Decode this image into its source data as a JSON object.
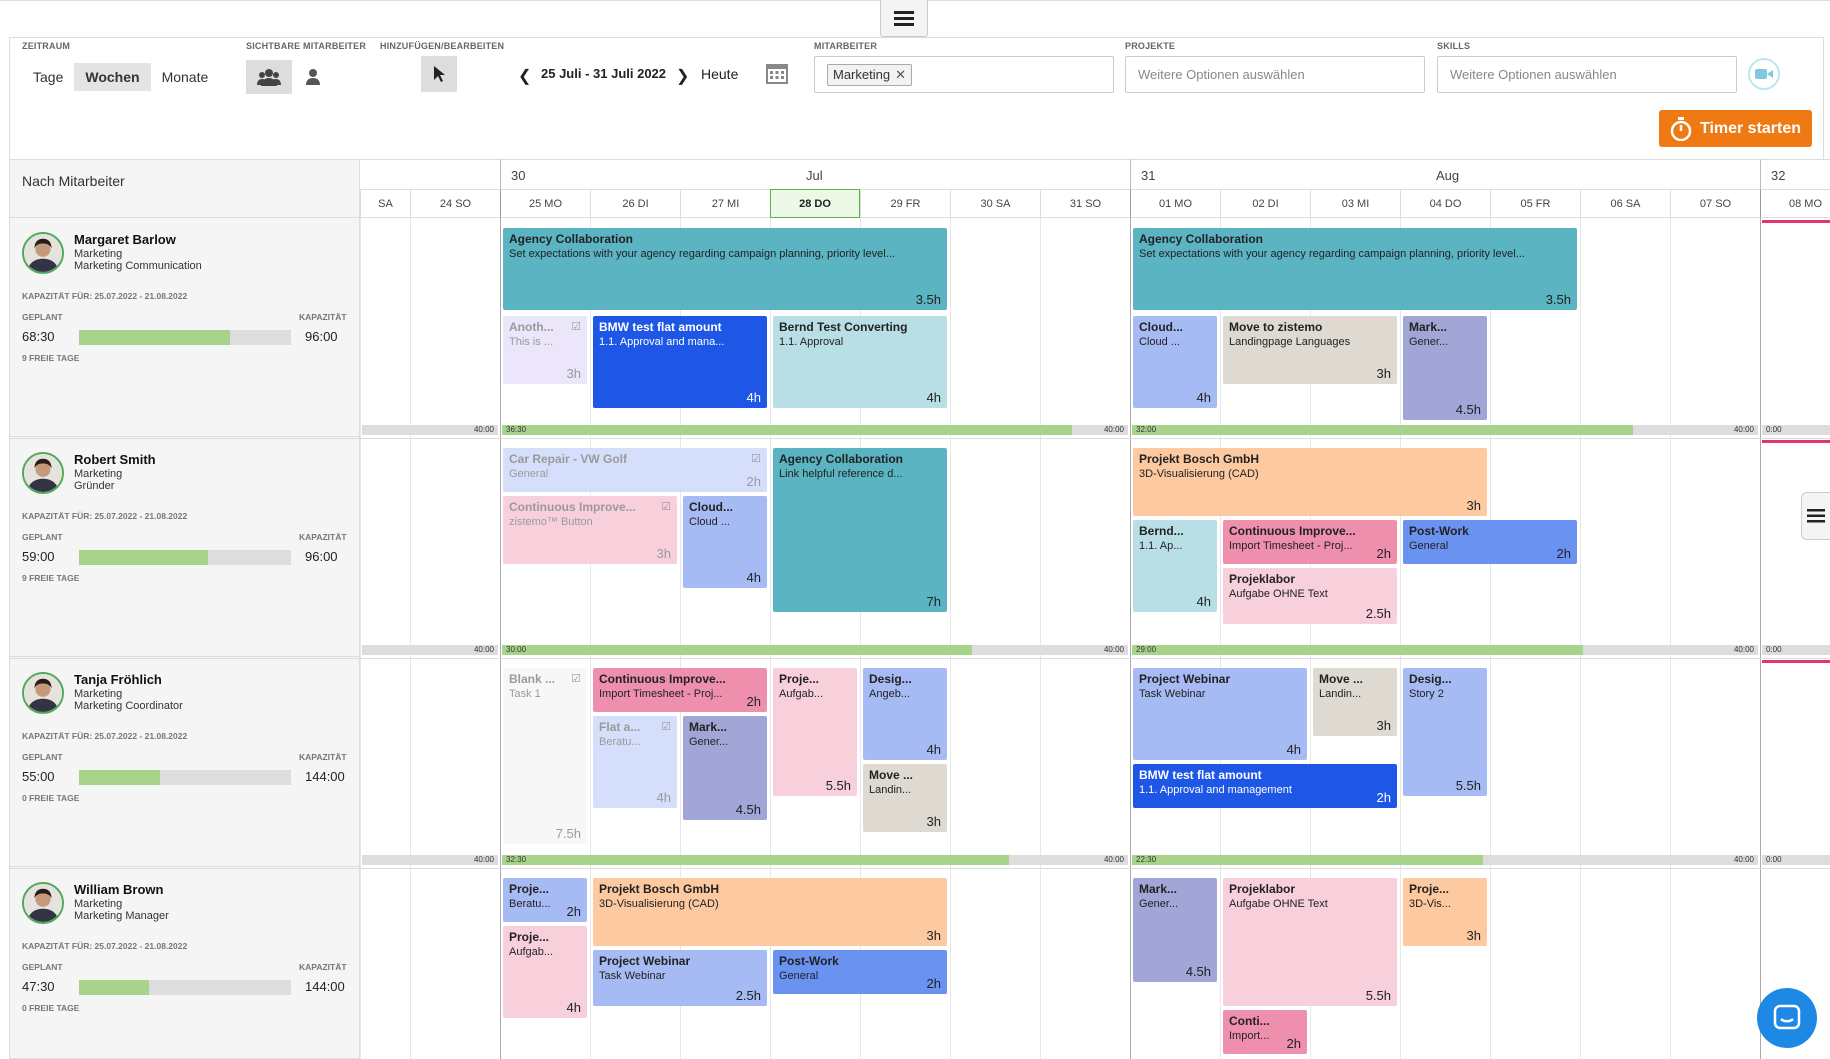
{
  "toolbar": {
    "zeitraum_label": "ZEITRAUM",
    "sichtbare_label": "SICHTBARE MITARBEITER",
    "hinzufuegen_label": "HINZUFÜGEN/BEARBEITEN",
    "mitarbeiter_label": "MITARBEITER",
    "projekte_label": "PROJEKTE",
    "skills_label": "SKILLS",
    "tage": "Tage",
    "wochen": "Wochen",
    "monate": "Monate",
    "date_range": "25 Juli - 31 Juli 2022",
    "heute": "Heute",
    "mitarbeiter_chip": "Marketing",
    "projekte_placeholder": "Weitere Optionen auswählen",
    "skills_placeholder": "Weitere Optionen auswählen",
    "timer": "Timer starten"
  },
  "calendar": {
    "group_label": "Nach Mitarbeiter",
    "weeks": [
      {
        "num": "30",
        "month": "Jul"
      },
      {
        "num": "31",
        "month": "Aug"
      },
      {
        "num": "32",
        "month": ""
      }
    ],
    "days": [
      "SA",
      "24 SO",
      "25 MO",
      "26 DI",
      "27 MI",
      "28 DO",
      "29 FR",
      "30 SA",
      "31 SO",
      "01 MO",
      "02 DI",
      "03 MI",
      "04 DO",
      "05 FR",
      "06 SA",
      "07 SO",
      "08 MO"
    ],
    "today": "28 DO"
  },
  "employees": [
    {
      "name": "Margaret Barlow",
      "dept": "Marketing",
      "role": "Marketing Communication",
      "kap": "KAPAZITÄT FÜR: 25.07.2022 - 21.08.2022",
      "geplant_label": "GEPLANT",
      "kapazitaet_label": "KAPAZITÄT",
      "geplant": "68:30",
      "kapazitaet": "96:00",
      "progress": 0.71,
      "free": "9 FREIE TAGE",
      "caps": [
        {
          "a": "",
          "b": "40:00"
        },
        {
          "a": "36:30",
          "b": "40:00",
          "p": 0.91
        },
        {
          "a": "32:00",
          "b": "40:00",
          "p": 0.8
        },
        {
          "a": "0:00",
          "b": ""
        }
      ]
    },
    {
      "name": "Robert Smith",
      "dept": "Marketing",
      "role": "Gründer",
      "kap": "KAPAZITÄT FÜR: 25.07.2022 - 21.08.2022",
      "geplant_label": "GEPLANT",
      "kapazitaet_label": "KAPAZITÄT",
      "geplant": "59:00",
      "kapazitaet": "96:00",
      "progress": 0.61,
      "free": "9 FREIE TAGE",
      "caps": [
        {
          "a": "",
          "b": "40:00"
        },
        {
          "a": "30:00",
          "b": "40:00",
          "p": 0.75
        },
        {
          "a": "29:00",
          "b": "40:00",
          "p": 0.72
        },
        {
          "a": "0:00",
          "b": ""
        }
      ]
    },
    {
      "name": "Tanja Fröhlich",
      "dept": "Marketing",
      "role": "Marketing Coordinator",
      "kap": "KAPAZITÄT FÜR: 25.07.2022 - 21.08.2022",
      "geplant_label": "GEPLANT",
      "kapazitaet_label": "KAPAZITÄT",
      "geplant": "55:00",
      "kapazitaet": "144:00",
      "progress": 0.38,
      "free": "0 FREIE TAGE",
      "caps": [
        {
          "a": "",
          "b": "40:00"
        },
        {
          "a": "32:30",
          "b": "40:00",
          "p": 0.81
        },
        {
          "a": "22:30",
          "b": "40:00",
          "p": 0.56
        },
        {
          "a": "0:00",
          "b": ""
        }
      ]
    },
    {
      "name": "William Brown",
      "dept": "Marketing",
      "role": "Marketing Manager",
      "kap": "KAPAZITÄT FÜR: 25.07.2022 - 21.08.2022",
      "geplant_label": "GEPLANT",
      "kapazitaet_label": "KAPAZITÄT",
      "geplant": "47:30",
      "kapazitaet": "144:00",
      "progress": 0.33,
      "free": "0 FREIE TAGE",
      "caps": []
    }
  ],
  "colors": {
    "teal": "#5ab4c1",
    "blue": "#1e56e6",
    "lightblue": "#b9dfe6",
    "grey": "#dedad2",
    "purple": "#a1a6d6",
    "pink": "#f8d0dc",
    "hotpink": "#ef8fae",
    "peach": "#fdc9a0",
    "periwinkle": "#a6baf4",
    "medblue": "#6a92f1",
    "lavender": "#ece6fb",
    "paleblue": "#d5dffb",
    "today": "#eef8e7",
    "accent": "#ef7a14"
  },
  "tasks": [
    {
      "r": 0,
      "c": 2,
      "w": 5,
      "t": 0,
      "hgt": 82,
      "col": "teal",
      "title": "Agency Collaboration",
      "sub": "Set expectations with your agency regarding campaign planning, priority level...",
      "hours": "3.5h"
    },
    {
      "r": 0,
      "c": 9,
      "w": 5,
      "t": 0,
      "hgt": 82,
      "col": "teal",
      "title": "Agency Collaboration",
      "sub": "Set expectations with your agency regarding campaign planning, priority level...",
      "hours": "3.5h"
    },
    {
      "r": 0,
      "c": 2,
      "w": 1,
      "t": 88,
      "hgt": 68,
      "col": "lavender",
      "title": "Anoth...",
      "sub": "This is ...",
      "hours": "3h",
      "done": true
    },
    {
      "r": 0,
      "c": 3,
      "w": 2,
      "t": 88,
      "hgt": 92,
      "col": "blue",
      "title": "BMW test flat amount",
      "sub": "1.1. Approval and mana...",
      "hours": "4h",
      "light": true
    },
    {
      "r": 0,
      "c": 5,
      "w": 2,
      "t": 88,
      "hgt": 92,
      "col": "lightblue",
      "title": "Bernd Test Converting",
      "sub": "1.1. Approval",
      "hours": "4h"
    },
    {
      "r": 0,
      "c": 9,
      "w": 1,
      "t": 88,
      "hgt": 92,
      "col": "periwinkle",
      "title": "Cloud...",
      "sub": "Cloud ...",
      "hours": "4h"
    },
    {
      "r": 0,
      "c": 10,
      "w": 2,
      "t": 88,
      "hgt": 68,
      "col": "grey",
      "title": "Move to zistemo",
      "sub": "Landingpage Languages",
      "hours": "3h"
    },
    {
      "r": 0,
      "c": 12,
      "w": 1,
      "t": 88,
      "hgt": 104,
      "col": "purple",
      "title": "Mark...",
      "sub": "Gener...",
      "hours": "4.5h"
    },
    {
      "r": 1,
      "c": 2,
      "w": 3,
      "t": 0,
      "hgt": 44,
      "col": "paleblue",
      "title": "Car Repair - VW Golf",
      "sub": "General",
      "hours": "2h",
      "done": true
    },
    {
      "r": 1,
      "c": 5,
      "w": 2,
      "t": 0,
      "hgt": 164,
      "col": "teal",
      "title": "Agency Collaboration",
      "sub": "Link helpful reference d...",
      "hours": "7h"
    },
    {
      "r": 1,
      "c": 9,
      "w": 4,
      "t": 0,
      "hgt": 68,
      "col": "peach",
      "title": "Projekt Bosch GmbH",
      "sub": "3D-Visualisierung (CAD)",
      "hours": "3h"
    },
    {
      "r": 1,
      "c": 2,
      "w": 2,
      "t": 48,
      "hgt": 68,
      "col": "pink",
      "title": "Continuous Improve...",
      "sub": "zistemo™ Button",
      "hours": "3h",
      "done": true
    },
    {
      "r": 1,
      "c": 4,
      "w": 1,
      "t": 48,
      "hgt": 92,
      "col": "periwinkle",
      "title": "Cloud...",
      "sub": "Cloud ...",
      "hours": "4h"
    },
    {
      "r": 1,
      "c": 9,
      "w": 1,
      "t": 72,
      "hgt": 92,
      "col": "lightblue",
      "title": "Bernd...",
      "sub": "1.1. Ap...",
      "hours": "4h"
    },
    {
      "r": 1,
      "c": 10,
      "w": 2,
      "t": 72,
      "hgt": 44,
      "col": "hotpink",
      "title": "Continuous Improve...",
      "sub": "Import Timesheet - Proj...",
      "hours": "2h"
    },
    {
      "r": 1,
      "c": 12,
      "w": 2,
      "t": 72,
      "hgt": 44,
      "col": "medblue",
      "title": "Post-Work",
      "sub": "General",
      "hours": "2h"
    },
    {
      "r": 1,
      "c": 10,
      "w": 2,
      "t": 120,
      "hgt": 56,
      "col": "pink",
      "title": "Projeklabor",
      "sub": "Aufgabe OHNE Text",
      "hours": "2.5h"
    },
    {
      "r": 2,
      "c": 2,
      "w": 1,
      "t": 0,
      "hgt": 176,
      "col": "white",
      "title": "Blank ...",
      "sub": "Task 1",
      "hours": "7.5h",
      "done": true
    },
    {
      "r": 2,
      "c": 3,
      "w": 2,
      "t": 0,
      "hgt": 44,
      "col": "hotpink",
      "title": "Continuous Improve...",
      "sub": "Import Timesheet - Proj...",
      "hours": "2h"
    },
    {
      "r": 2,
      "c": 5,
      "w": 1,
      "t": 0,
      "hgt": 128,
      "col": "pink",
      "title": "Proje...",
      "sub": "Aufgab...",
      "hours": "5.5h"
    },
    {
      "r": 2,
      "c": 6,
      "w": 1,
      "t": 0,
      "hgt": 92,
      "col": "periwinkle",
      "title": "Desig...",
      "sub": "Angeb...",
      "hours": "4h"
    },
    {
      "r": 2,
      "c": 9,
      "w": 2,
      "t": 0,
      "hgt": 92,
      "col": "periwinkle",
      "title": "Project Webinar",
      "sub": "Task Webinar",
      "hours": "4h"
    },
    {
      "r": 2,
      "c": 11,
      "w": 1,
      "t": 0,
      "hgt": 68,
      "col": "grey",
      "title": "Move ...",
      "sub": "Landin...",
      "hours": "3h"
    },
    {
      "r": 2,
      "c": 12,
      "w": 1,
      "t": 0,
      "hgt": 128,
      "col": "periwinkle",
      "title": "Desig...",
      "sub": "Story 2",
      "hours": "5.5h"
    },
    {
      "r": 2,
      "c": 3,
      "w": 1,
      "t": 48,
      "hgt": 92,
      "col": "paleblue",
      "title": "Flat a...",
      "sub": "Beratu...",
      "hours": "4h",
      "done": true
    },
    {
      "r": 2,
      "c": 4,
      "w": 1,
      "t": 48,
      "hgt": 104,
      "col": "purple",
      "title": "Mark...",
      "sub": "Gener...",
      "hours": "4.5h"
    },
    {
      "r": 2,
      "c": 6,
      "w": 1,
      "t": 96,
      "hgt": 68,
      "col": "grey",
      "title": "Move ...",
      "sub": "Landin...",
      "hours": "3h"
    },
    {
      "r": 2,
      "c": 9,
      "w": 3,
      "t": 96,
      "hgt": 44,
      "col": "blue",
      "title": "BMW test flat amount",
      "sub": "1.1. Approval and management",
      "hours": "2h",
      "light": true
    },
    {
      "r": 3,
      "c": 2,
      "w": 1,
      "t": 0,
      "hgt": 44,
      "col": "periwinkle",
      "title": "Proje...",
      "sub": "Beratu...",
      "hours": "2h"
    },
    {
      "r": 3,
      "c": 3,
      "w": 4,
      "t": 0,
      "hgt": 68,
      "col": "peach",
      "title": "Projekt Bosch GmbH",
      "sub": "3D-Visualisierung (CAD)",
      "hours": "3h"
    },
    {
      "r": 3,
      "c": 9,
      "w": 1,
      "t": 0,
      "hgt": 104,
      "col": "purple",
      "title": "Mark...",
      "sub": "Gener...",
      "hours": "4.5h"
    },
    {
      "r": 3,
      "c": 10,
      "w": 2,
      "t": 0,
      "hgt": 128,
      "col": "pink",
      "title": "Projeklabor",
      "sub": "Aufgabe OHNE Text",
      "hours": "5.5h"
    },
    {
      "r": 3,
      "c": 12,
      "w": 1,
      "t": 0,
      "hgt": 68,
      "col": "peach",
      "title": "Proje...",
      "sub": "3D-Vis...",
      "hours": "3h"
    },
    {
      "r": 3,
      "c": 2,
      "w": 1,
      "t": 48,
      "hgt": 92,
      "col": "pink",
      "title": "Proje...",
      "sub": "Aufgab...",
      "hours": "4h"
    },
    {
      "r": 3,
      "c": 3,
      "w": 2,
      "t": 72,
      "hgt": 56,
      "col": "periwinkle",
      "title": "Project Webinar",
      "sub": "Task Webinar",
      "hours": "2.5h"
    },
    {
      "r": 3,
      "c": 5,
      "w": 2,
      "t": 72,
      "hgt": 44,
      "col": "medblue",
      "title": "Post-Work",
      "sub": "General",
      "hours": "2h"
    },
    {
      "r": 3,
      "c": 10,
      "w": 1,
      "t": 132,
      "hgt": 44,
      "col": "hotpink",
      "title": "Conti...",
      "sub": "Import...",
      "hours": "2h"
    }
  ]
}
